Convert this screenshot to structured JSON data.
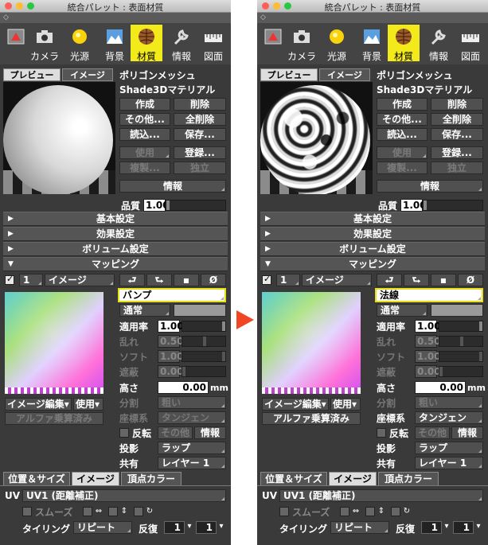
{
  "window_title": "統合パレット : 表面材質",
  "toolbar": {
    "items": [
      {
        "label": "",
        "icon": "shade-tool-icon"
      },
      {
        "label": "カメラ",
        "icon": "camera-icon"
      },
      {
        "label": "光源",
        "icon": "light-sun-icon"
      },
      {
        "label": "背景",
        "icon": "background-icon"
      },
      {
        "label": "材質",
        "icon": "material-sphere-icon"
      },
      {
        "label": "情報",
        "icon": "wrench-icon"
      },
      {
        "label": "図面",
        "icon": "ruler-icon"
      }
    ],
    "selected": "材質"
  },
  "preview_tabs": [
    "プレビュー",
    "イメージ"
  ],
  "object_name": "ポリゴンメッシュ",
  "material_name": "Shade3Dマテリアル",
  "buttons": {
    "create": "作成",
    "delete": "削除",
    "other": "その他...",
    "delete_all": "全削除",
    "load": "読込...",
    "save": "保存...",
    "use": "使用",
    "register": "登録...",
    "duplicate": "複製...",
    "independent": "独立",
    "info": "情報"
  },
  "quality": {
    "label": "品質",
    "value": "1.00"
  },
  "sections": [
    {
      "label": "基本設定",
      "expanded": false
    },
    {
      "label": "効果設定",
      "expanded": false
    },
    {
      "label": "ボリューム設定",
      "expanded": false
    },
    {
      "label": "マッピング",
      "expanded": true
    }
  ],
  "mapping": {
    "layer_number": "1",
    "layer_type": "イメージ",
    "icons": [
      "load-arrow-icon",
      "store-arrow-icon",
      "copy-square-icon",
      "clear-slash-icon"
    ],
    "clear_glyph": "Ø",
    "image_edit": "イメージ編集",
    "use": "使用",
    "alpha": "アルファ乗算済み",
    "blend_mode": "通常",
    "rate_label": "適用率",
    "rate_value": "1.00",
    "disorder_label": "乱れ",
    "disorder_value": "0.50",
    "soft_label": "ソフト",
    "soft_value": "1.00",
    "shield_label": "遮蔽",
    "shield_value": "0.00",
    "height_label": "高さ",
    "height_value": "0.00",
    "height_unit": "mm",
    "divide_label": "分割",
    "divide_value": "粗い",
    "coord_label": "座標系",
    "coord_value": "タンジェン",
    "invert_label": "反転",
    "other_label": "その他",
    "info_label": "情報",
    "projection_label": "投影",
    "projection_value": "ラップ",
    "share_label": "共有",
    "share_value": "レイヤー 1"
  },
  "bottom_tabs": [
    "位置＆サイズ",
    "イメージ",
    "頂点カラー"
  ],
  "uv": {
    "label": "UV",
    "value": "UV1 (距離補正)"
  },
  "smooth_label": "スムーズ",
  "tiling": {
    "label": "タイリング",
    "value": "リピート",
    "repeat_label": "反復",
    "repeat_x": "1",
    "repeat_y": "1"
  },
  "left_panel": {
    "mapping_type": "バンプ"
  },
  "right_panel": {
    "mapping_type": "法線"
  }
}
